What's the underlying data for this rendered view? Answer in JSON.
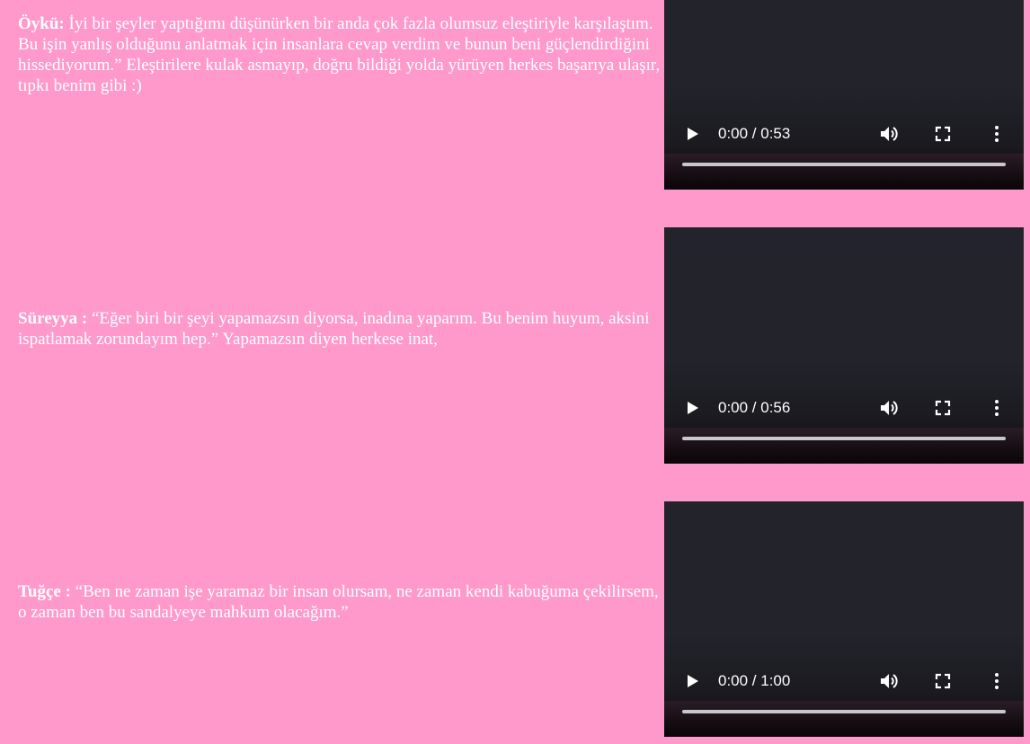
{
  "testimonials": [
    {
      "name": "Öykü:",
      "text": " İyi bir şeyler yaptığımı düşünürken bir anda çok fazla olumsuz eleştiriyle karşılaştım. Bu işin yanlış olduğunu anlatmak için insanlara cevap verdim ve bunun beni güçlendirdiğini hissediyorum.” Eleştirilere kulak asmayıp, doğru bildiği yolda yürüyen herkes başarıya ulaşır, tıpkı benim gibi :)",
      "video": {
        "time": "0:00 / 0:53",
        "progress": 0
      }
    },
    {
      "name": "Süreyya :",
      "text": " “Eğer biri bir şeyi yapamazsın diyorsa, inadına yaparım. Bu benim huyum, aksini ispatlamak zorundayım hep.” Yapamazsın diyen herkese inat,",
      "video": {
        "time": "0:00 / 0:56",
        "progress": 0
      }
    },
    {
      "name": "Tuğçe :",
      "text": " “Ben ne zaman işe yaramaz bir insan olursam, ne zaman kendi kabuğuma çekilirsem, o zaman ben bu sandalyeye mahkum olacağım.”",
      "video": {
        "time": "0:00 / 1:00",
        "progress": 0
      }
    }
  ],
  "icons": {
    "play": "play-icon",
    "volume": "volume-icon",
    "fullscreen": "fullscreen-icon",
    "more": "more-options-icon"
  },
  "colors": {
    "background": "#ff99cc",
    "text": "#ffffff",
    "player": "#23232b",
    "progress": "#c8c8cc"
  }
}
